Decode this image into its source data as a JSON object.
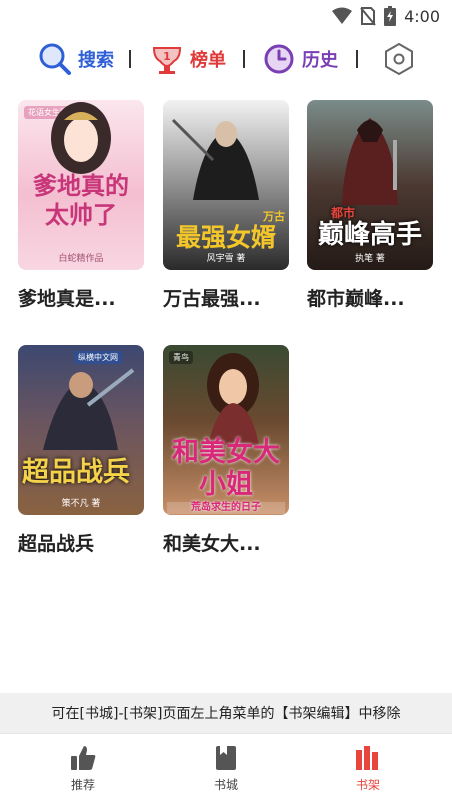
{
  "status_bar": {
    "time": "4:00",
    "icons": [
      "wifi-icon",
      "no-sim-icon",
      "battery-icon"
    ]
  },
  "top_nav": {
    "items": [
      {
        "label": "搜索",
        "icon": "search-icon",
        "color": "#2f5fd6"
      },
      {
        "label": "榜单",
        "icon": "trophy-icon",
        "color": "#e03a3a"
      },
      {
        "label": "历史",
        "icon": "clock-icon",
        "color": "#7a3fb3"
      }
    ],
    "settings_icon": "hexagon-settings-icon"
  },
  "books": [
    {
      "name": "爹地真是...",
      "cover_title": "爹地真的太帅了",
      "cover_author": "白蛇精作品",
      "cover_badge": "花语女生网"
    },
    {
      "name": "万古最强...",
      "cover_title": "最强女婿",
      "cover_subtitle": "万古",
      "cover_author": "风宇雪 著"
    },
    {
      "name": "都市巅峰...",
      "cover_title": "巅峰高手",
      "cover_subtitle": "都市",
      "cover_author": "执笔 著"
    },
    {
      "name": "超品战兵",
      "cover_title": "超品战兵",
      "cover_author": "策不凡 著",
      "cover_badge": "纵横中文网"
    },
    {
      "name": "和美女大...",
      "cover_title": "和美女大小姐",
      "cover_subtitle": "荒岛求生的日子",
      "cover_badge": "青鸟"
    }
  ],
  "notice": "可在[书城]-[书架]页面左上角菜单的【书架编辑】中移除",
  "tab_bar": {
    "tabs": [
      {
        "label": "推荐",
        "icon": "thumbs-up-icon"
      },
      {
        "label": "书城",
        "icon": "book-icon"
      },
      {
        "label": "书架",
        "icon": "bookshelf-icon",
        "active": true
      }
    ],
    "accent": "#e8453c"
  }
}
